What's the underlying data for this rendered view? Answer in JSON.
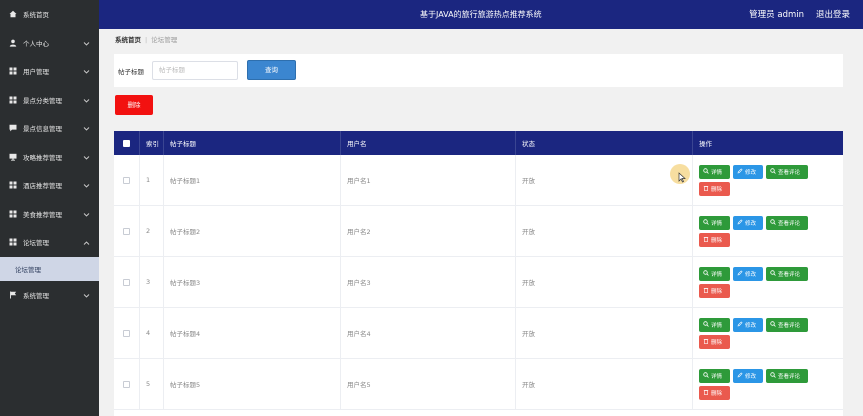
{
  "app": {
    "title": "基于JAVA的旅行旅游热点推荐系统",
    "admin_label": "管理员 admin",
    "logout_label": "退出登录"
  },
  "sidebar": {
    "items": [
      {
        "label": "系统首页",
        "icon": "home-icon",
        "has_chevron": false
      },
      {
        "label": "个人中心",
        "icon": "user-icon",
        "has_chevron": true
      },
      {
        "label": "用户管理",
        "icon": "grid-icon",
        "has_chevron": true
      },
      {
        "label": "景点分类管理",
        "icon": "grid-icon",
        "has_chevron": true
      },
      {
        "label": "景点信息管理",
        "icon": "chat-icon",
        "has_chevron": true
      },
      {
        "label": "攻略推荐管理",
        "icon": "monitor-icon",
        "has_chevron": true
      },
      {
        "label": "酒店推荐管理",
        "icon": "grid-icon",
        "has_chevron": true
      },
      {
        "label": "美食推荐管理",
        "icon": "grid-icon",
        "has_chevron": true
      },
      {
        "label": "论坛管理",
        "icon": "grid-icon",
        "has_chevron": true,
        "expanded": true
      }
    ],
    "sub_item": "论坛管理",
    "last_item": {
      "label": "系统管理",
      "icon": "flag-icon"
    }
  },
  "breadcrumb": {
    "home": "系统首页",
    "current": "论坛管理"
  },
  "search": {
    "label": "帖子标题",
    "placeholder": "帖子标题",
    "button": "查询"
  },
  "toolbar": {
    "delete_label": "删除"
  },
  "table": {
    "headers": {
      "index": "索引",
      "title": "帖子标题",
      "user": "用户名",
      "status": "状态",
      "ops": "操作"
    },
    "rows": [
      {
        "index": "1",
        "title": "帖子标题1",
        "user": "用户名1",
        "status": "开放"
      },
      {
        "index": "2",
        "title": "帖子标题2",
        "user": "用户名2",
        "status": "开放"
      },
      {
        "index": "3",
        "title": "帖子标题3",
        "user": "用户名3",
        "status": "开放"
      },
      {
        "index": "4",
        "title": "帖子标题4",
        "user": "用户名4",
        "status": "开放"
      },
      {
        "index": "5",
        "title": "帖子标题5",
        "user": "用户名5",
        "status": "开放"
      }
    ],
    "op_labels": {
      "detail": "详情",
      "edit": "修改",
      "comments": "查看评论",
      "remove": "删除"
    }
  },
  "colors": {
    "sidebar_bg": "#2b2e30",
    "header_bg": "#1b2680",
    "search_button": "#3b86d0",
    "delete_button": "#f21110",
    "detail_button": "#2e9a3a",
    "edit_button": "#2b96e6",
    "remove_button": "#ea5a4e"
  }
}
